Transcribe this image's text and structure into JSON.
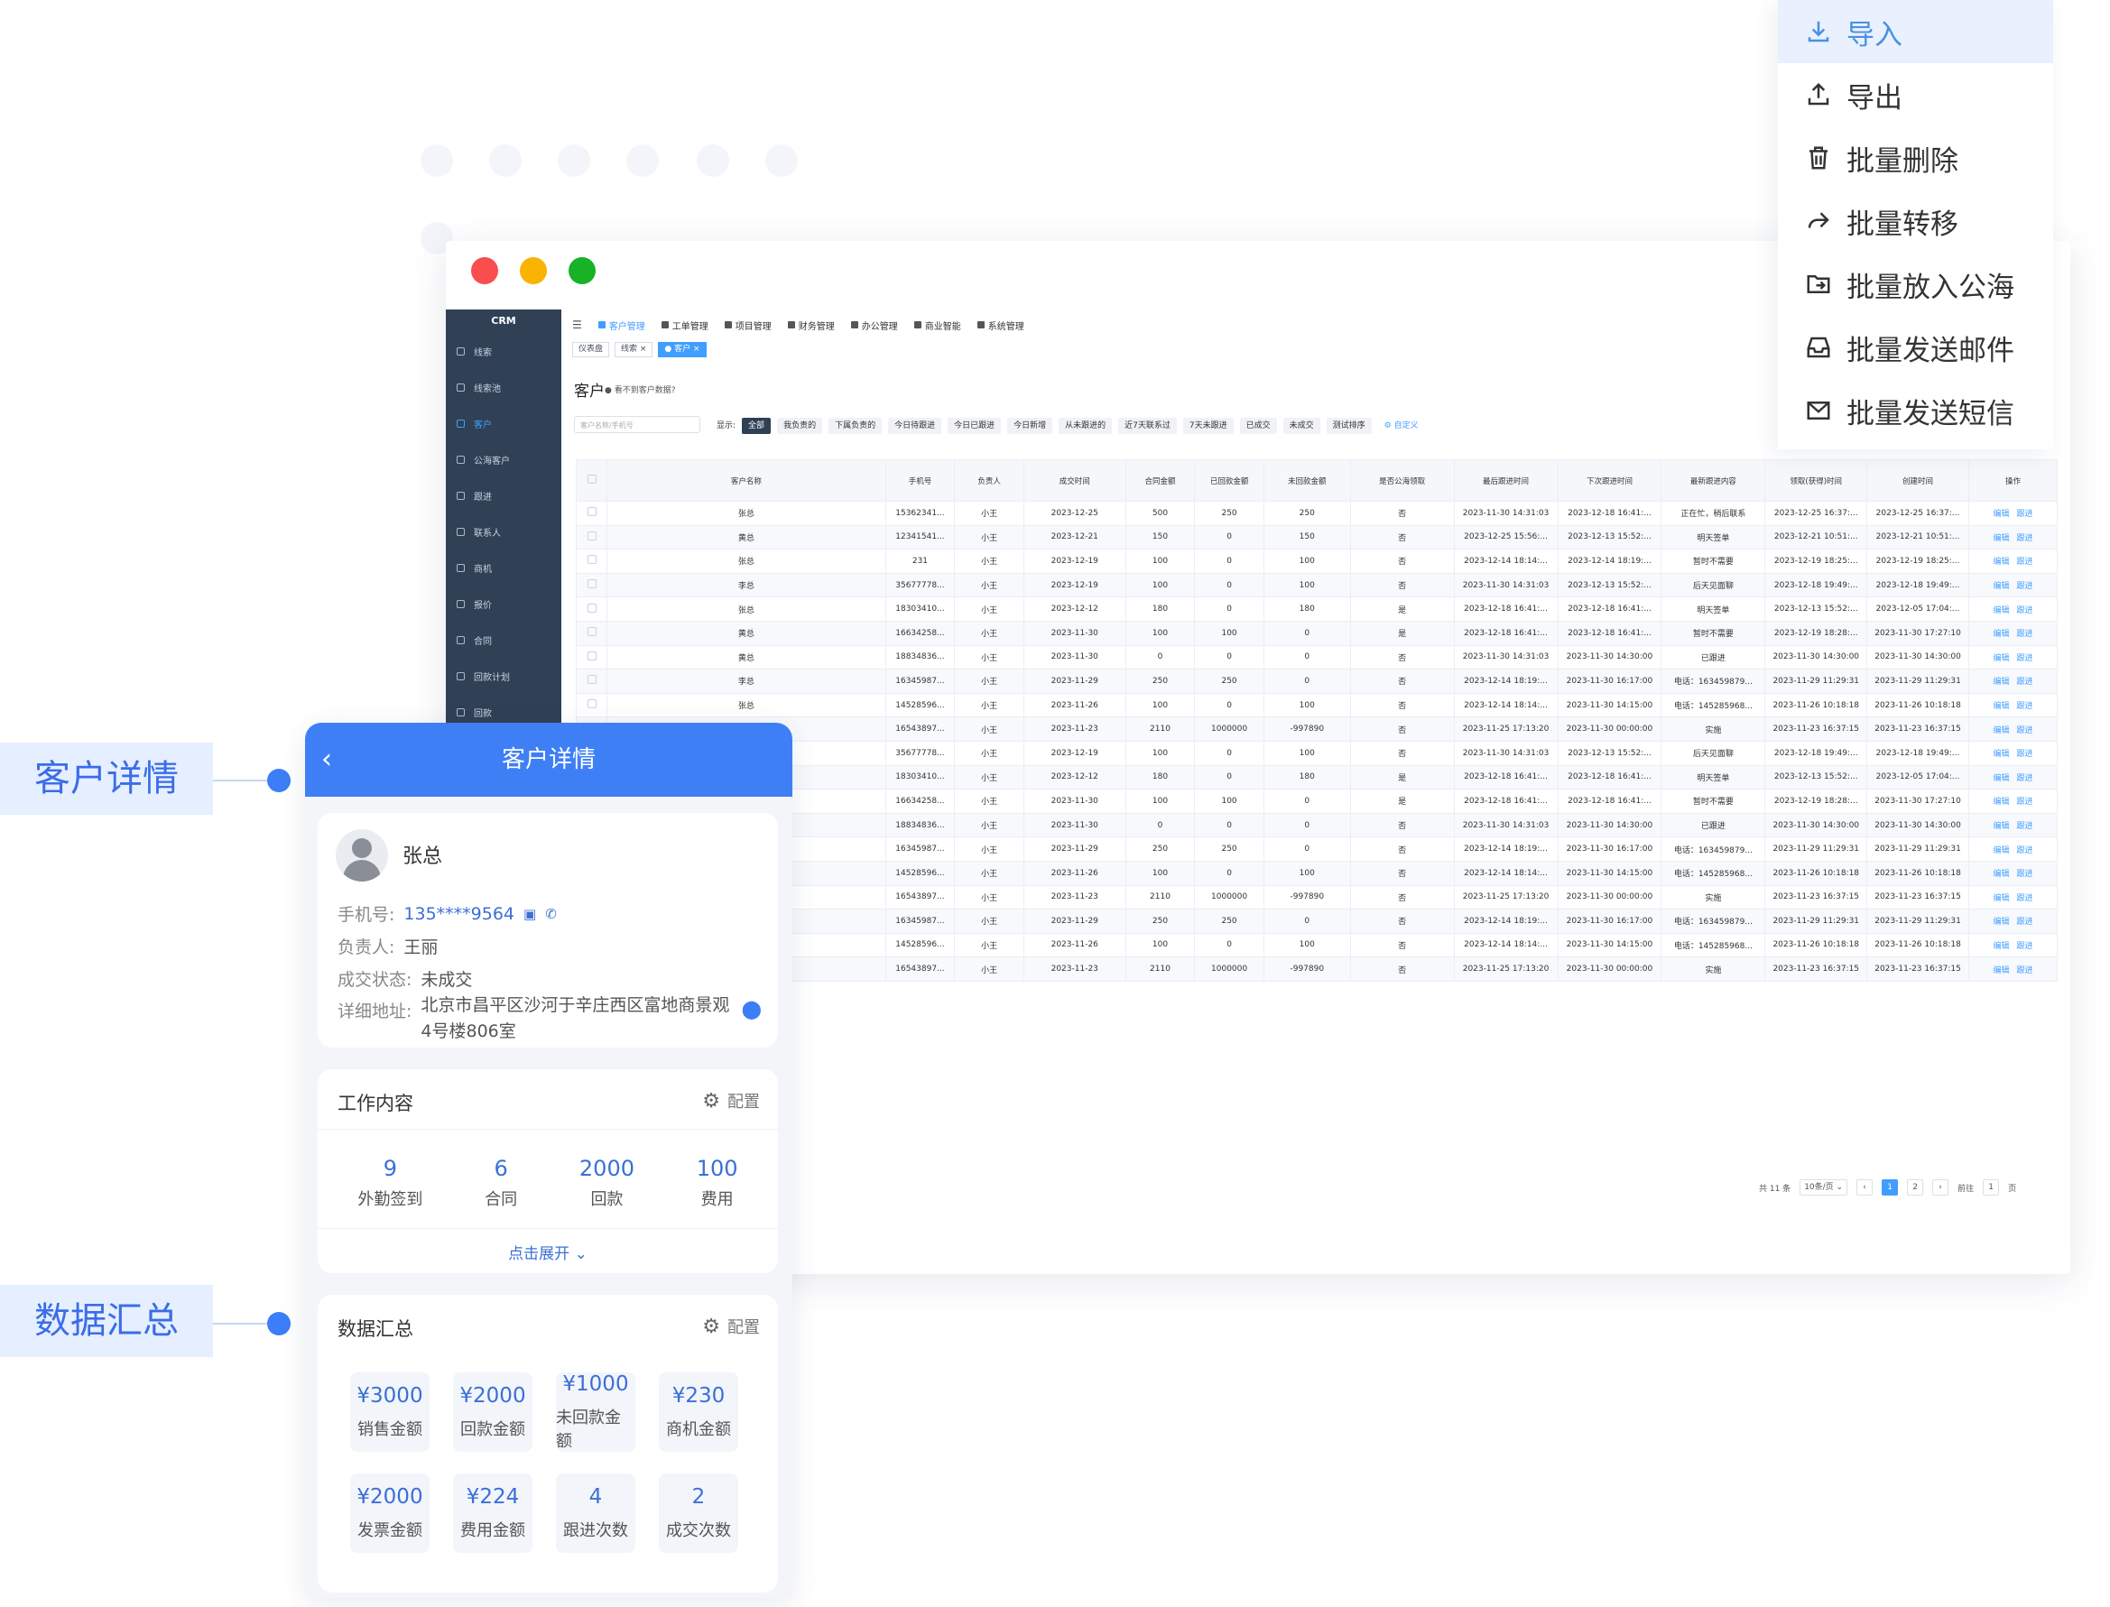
{
  "window": {
    "crm_logo": "CRM",
    "sidebar": [
      {
        "label": "线索"
      },
      {
        "label": "线索池"
      },
      {
        "label": "客户"
      },
      {
        "label": "公海客户"
      },
      {
        "label": "跟进"
      },
      {
        "label": "联系人"
      },
      {
        "label": "商机"
      },
      {
        "label": "报价"
      },
      {
        "label": "合同"
      },
      {
        "label": "回款计划"
      },
      {
        "label": "回款"
      }
    ],
    "topnav": [
      {
        "label": "客户管理"
      },
      {
        "label": "工单管理"
      },
      {
        "label": "项目管理"
      },
      {
        "label": "财务管理"
      },
      {
        "label": "办公管理"
      },
      {
        "label": "商业智能"
      },
      {
        "label": "系统管理"
      }
    ],
    "tabs": [
      {
        "label": "仪表盘"
      },
      {
        "label": "线索 ×"
      },
      {
        "label": "● 客户 ×"
      }
    ],
    "page_title": "客户",
    "page_hint": "● 看不到客户数据?",
    "search_placeholder": "客户名称/手机号",
    "filter_label": "显示:",
    "filters": [
      {
        "label": "全部"
      },
      {
        "label": "我负责的"
      },
      {
        "label": "下属负责的"
      },
      {
        "label": "今日待跟进"
      },
      {
        "label": "今日已跟进"
      },
      {
        "label": "今日新增"
      },
      {
        "label": "从未跟进的"
      },
      {
        "label": "近7天联系过"
      },
      {
        "label": "7天未跟进"
      },
      {
        "label": "已成交"
      },
      {
        "label": "未成交"
      },
      {
        "label": "测试排序"
      }
    ],
    "custom_label": "⚙ 自定义",
    "columns": [
      "客户名称",
      "手机号",
      "负责人",
      "成交时间",
      "合同金额",
      "已回款金额",
      "未回款金额",
      "是否公海领取",
      "最后跟进时间",
      "下次跟进时间",
      "最新跟进内容",
      "领取(获得)时间",
      "创建时间",
      "操作"
    ],
    "rows": [
      [
        "张总",
        "15362341...",
        "小王",
        "2023-12-25",
        "500",
        "250",
        "250",
        "否",
        "2023-11-30 14:31:03",
        "2023-12-18 16:41:...",
        "正在忙，稍后联系",
        "2023-12-25 16:37:...",
        "2023-12-25 16:37:..."
      ],
      [
        "黄总",
        "12341541...",
        "小王",
        "2023-12-21",
        "150",
        "0",
        "150",
        "否",
        "2023-12-25 15:56:...",
        "2023-12-13 15:52:...",
        "明天签单",
        "2023-12-21 10:51:...",
        "2023-12-21 10:51:..."
      ],
      [
        "张总",
        "231",
        "小王",
        "2023-12-19",
        "100",
        "0",
        "100",
        "否",
        "2023-12-14 18:14:...",
        "2023-12-14 18:19:...",
        "暂时不需要",
        "2023-12-19 18:25:...",
        "2023-12-19 18:25:..."
      ],
      [
        "李总",
        "35677778...",
        "小王",
        "2023-12-19",
        "100",
        "0",
        "100",
        "否",
        "2023-11-30 14:31:03",
        "2023-12-13 15:52:...",
        "后天见面聊",
        "2023-12-18 19:49:...",
        "2023-12-18 19:49:..."
      ],
      [
        "张总",
        "18303410...",
        "小王",
        "2023-12-12",
        "180",
        "0",
        "180",
        "是",
        "2023-12-18 16:41:...",
        "2023-12-18 16:41:...",
        "明天签单",
        "2023-12-13 15:52:...",
        "2023-12-05 17:04:..."
      ],
      [
        "黄总",
        "16634258...",
        "小王",
        "2023-11-30",
        "100",
        "100",
        "0",
        "是",
        "2023-12-18 16:41:...",
        "2023-12-18 16:41:...",
        "暂时不需要",
        "2023-12-19 18:28:...",
        "2023-11-30 17:27:10"
      ],
      [
        "黄总",
        "18834836...",
        "小王",
        "2023-11-30",
        "0",
        "0",
        "0",
        "否",
        "2023-11-30 14:31:03",
        "2023-11-30 14:30:00",
        "已跟进",
        "2023-11-30 14:30:00",
        "2023-11-30 14:30:00"
      ],
      [
        "李总",
        "16345987...",
        "小王",
        "2023-11-29",
        "250",
        "250",
        "0",
        "否",
        "2023-12-14 18:19:...",
        "2023-11-30 16:17:00",
        "电话：163459879...",
        "2023-11-29 11:29:31",
        "2023-11-29 11:29:31"
      ],
      [
        "张总",
        "14528596...",
        "小王",
        "2023-11-26",
        "100",
        "0",
        "100",
        "否",
        "2023-12-14 18:14:...",
        "2023-11-30 14:15:00",
        "电话：145285968...",
        "2023-11-26 10:18:18",
        "2023-11-26 10:18:18"
      ],
      [
        "",
        "16543897...",
        "小王",
        "2023-11-23",
        "2110",
        "1000000",
        "-997890",
        "否",
        "2023-11-25 17:13:20",
        "2023-11-30 00:00:00",
        "实施",
        "2023-11-23 16:37:15",
        "2023-11-23 16:37:15"
      ],
      [
        "",
        "35677778...",
        "小王",
        "2023-12-19",
        "100",
        "0",
        "100",
        "否",
        "2023-11-30 14:31:03",
        "2023-12-13 15:52:...",
        "后天见面聊",
        "2023-12-18 19:49:...",
        "2023-12-18 19:49:..."
      ],
      [
        "",
        "18303410...",
        "小王",
        "2023-12-12",
        "180",
        "0",
        "180",
        "是",
        "2023-12-18 16:41:...",
        "2023-12-18 16:41:...",
        "明天签单",
        "2023-12-13 15:52:...",
        "2023-12-05 17:04:..."
      ],
      [
        "",
        "16634258...",
        "小王",
        "2023-11-30",
        "100",
        "100",
        "0",
        "是",
        "2023-12-18 16:41:...",
        "2023-12-18 16:41:...",
        "暂时不需要",
        "2023-12-19 18:28:...",
        "2023-11-30 17:27:10"
      ],
      [
        "",
        "18834836...",
        "小王",
        "2023-11-30",
        "0",
        "0",
        "0",
        "否",
        "2023-11-30 14:31:03",
        "2023-11-30 14:30:00",
        "已跟进",
        "2023-11-30 14:30:00",
        "2023-11-30 14:30:00"
      ],
      [
        "",
        "16345987...",
        "小王",
        "2023-11-29",
        "250",
        "250",
        "0",
        "否",
        "2023-12-14 18:19:...",
        "2023-11-30 16:17:00",
        "电话：163459879...",
        "2023-11-29 11:29:31",
        "2023-11-29 11:29:31"
      ],
      [
        "",
        "14528596...",
        "小王",
        "2023-11-26",
        "100",
        "0",
        "100",
        "否",
        "2023-12-14 18:14:...",
        "2023-11-30 14:15:00",
        "电话：145285968...",
        "2023-11-26 10:18:18",
        "2023-11-26 10:18:18"
      ],
      [
        "",
        "16543897...",
        "小王",
        "2023-11-23",
        "2110",
        "1000000",
        "-997890",
        "否",
        "2023-11-25 17:13:20",
        "2023-11-30 00:00:00",
        "实施",
        "2023-11-23 16:37:15",
        "2023-11-23 16:37:15"
      ],
      [
        "",
        "16345987...",
        "小王",
        "2023-11-29",
        "250",
        "250",
        "0",
        "否",
        "2023-12-14 18:19:...",
        "2023-11-30 16:17:00",
        "电话：163459879...",
        "2023-11-29 11:29:31",
        "2023-11-29 11:29:31"
      ],
      [
        "",
        "14528596...",
        "小王",
        "2023-11-26",
        "100",
        "0",
        "100",
        "否",
        "2023-12-14 18:14:...",
        "2023-11-30 14:15:00",
        "电话：145285968...",
        "2023-11-26 10:18:18",
        "2023-11-26 10:18:18"
      ],
      [
        "",
        "16543897...",
        "小王",
        "2023-11-23",
        "2110",
        "1000000",
        "-997890",
        "否",
        "2023-11-25 17:13:20",
        "2023-11-30 00:00:00",
        "实施",
        "2023-11-23 16:37:15",
        "2023-11-23 16:37:15"
      ]
    ],
    "actions": {
      "edit": "编辑",
      "follow": "跟进"
    },
    "pager": {
      "total": "共 11 条",
      "size": "10条/页 ⌄",
      "prev": "‹",
      "pages": [
        "1",
        "2"
      ],
      "next": "›",
      "goto": "前往",
      "page_input": "1",
      "page_unit": "页"
    }
  },
  "menu": [
    {
      "label": "导入",
      "icon": "download-icon"
    },
    {
      "label": "导出",
      "icon": "upload-icon"
    },
    {
      "label": "批量删除",
      "icon": "trash-icon"
    },
    {
      "label": "批量转移",
      "icon": "share-icon"
    },
    {
      "label": "批量放入公海",
      "icon": "folder-move-icon"
    },
    {
      "label": "批量发送邮件",
      "icon": "inbox-icon"
    },
    {
      "label": "批量发送短信",
      "icon": "mail-icon"
    }
  ],
  "labels": {
    "customer_detail": "客户详情",
    "data_summary": "数据汇总"
  },
  "phone": {
    "title": "客户详情",
    "name": "张总",
    "phone_label": "手机号:",
    "phone_value": "135****9564",
    "owner_label": "负责人:",
    "owner_value": "王丽",
    "status_label": "成交状态:",
    "status_value": "未成交",
    "address_label": "详细地址:",
    "address_value": "北京市昌平区沙河于辛庄西区富地商景观4号楼806室",
    "work_title": "工作内容",
    "config_label": "配置",
    "work_stats": [
      {
        "value": "9",
        "label": "外勤签到"
      },
      {
        "value": "6",
        "label": "合同"
      },
      {
        "value": "2000",
        "label": "回款"
      },
      {
        "value": "100",
        "label": "费用"
      }
    ],
    "expand": "点击展开",
    "summary_title": "数据汇总",
    "summary": [
      {
        "value": "¥3000",
        "label": "销售金额"
      },
      {
        "value": "¥2000",
        "label": "回款金额"
      },
      {
        "value": "¥1000",
        "label": "未回款金额"
      },
      {
        "value": "¥230",
        "label": "商机金额"
      },
      {
        "value": "¥2000",
        "label": "发票金额"
      },
      {
        "value": "¥224",
        "label": "费用金额"
      },
      {
        "value": "4",
        "label": "跟进次数"
      },
      {
        "value": "2",
        "label": "成交次数"
      }
    ]
  },
  "colors": {
    "accent": "#409eff",
    "phone_header": "#3f7ff6",
    "sidebar": "#304156"
  }
}
